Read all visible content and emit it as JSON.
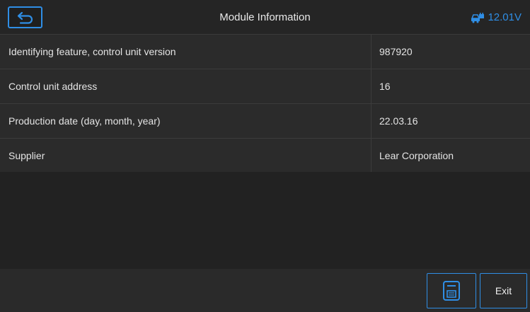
{
  "header": {
    "title": "Module Information",
    "battery_voltage": "12.01V",
    "back_icon": "back-arrow-icon",
    "battery_icon": "car-battery-icon"
  },
  "rows": [
    {
      "label": "Identifying feature, control unit version",
      "value": "987920"
    },
    {
      "label": "Control unit address",
      "value": "16"
    },
    {
      "label": "Production date (day, month, year)",
      "value": "22.03.16"
    },
    {
      "label": "Supplier",
      "value": "Lear Corporation"
    }
  ],
  "footer": {
    "save_icon": "save-icon",
    "exit_label": "Exit"
  },
  "colors": {
    "accent": "#2f8ee5",
    "background": "#1e1e1e"
  }
}
